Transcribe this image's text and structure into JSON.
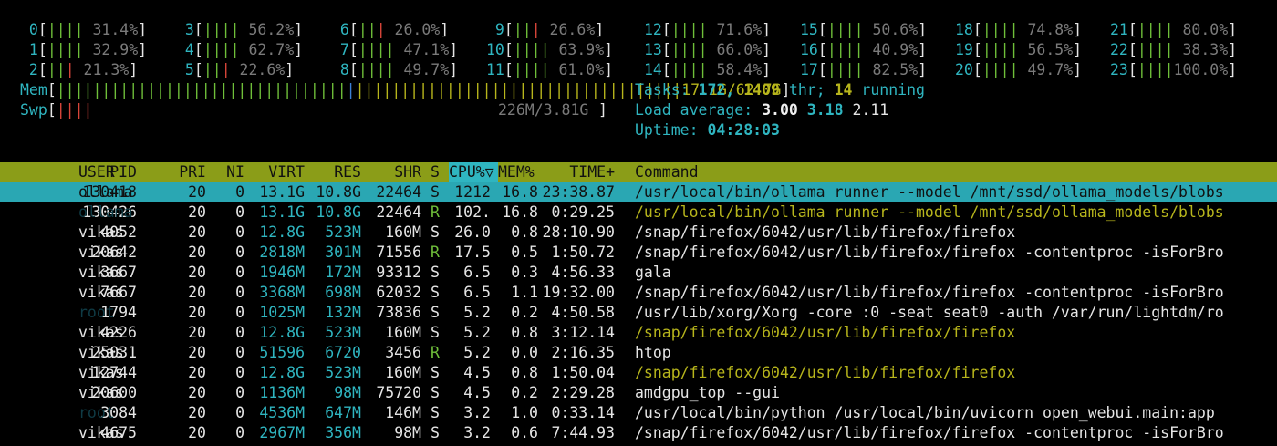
{
  "cpus": [
    {
      "id": "0",
      "pct": "31.4%"
    },
    {
      "id": "1",
      "pct": "32.9%"
    },
    {
      "id": "2",
      "pct": "21.3%"
    },
    {
      "id": "3",
      "pct": "56.2%"
    },
    {
      "id": "4",
      "pct": "62.7%"
    },
    {
      "id": "5",
      "pct": "22.6%"
    },
    {
      "id": "6",
      "pct": "26.0%"
    },
    {
      "id": "7",
      "pct": "47.1%"
    },
    {
      "id": "8",
      "pct": "49.7%"
    },
    {
      "id": "9",
      "pct": "26.6%"
    },
    {
      "id": "10",
      "pct": "63.9%"
    },
    {
      "id": "11",
      "pct": "61.0%"
    },
    {
      "id": "12",
      "pct": "71.6%"
    },
    {
      "id": "13",
      "pct": "66.0%"
    },
    {
      "id": "14",
      "pct": "58.4%"
    },
    {
      "id": "15",
      "pct": "50.6%"
    },
    {
      "id": "16",
      "pct": "40.9%"
    },
    {
      "id": "17",
      "pct": "82.5%"
    },
    {
      "id": "18",
      "pct": "74.8%"
    },
    {
      "id": "19",
      "pct": "56.5%"
    },
    {
      "id": "20",
      "pct": "49.7%"
    },
    {
      "id": "21",
      "pct": "80.0%"
    },
    {
      "id": "22",
      "pct": "38.3%"
    },
    {
      "id": "23",
      "pct": "100.0%"
    }
  ],
  "mem": {
    "label": "Mem",
    "value": "17.1G/62.7G"
  },
  "swp": {
    "label": "Swp",
    "value": "226M/3.81G"
  },
  "tasks": {
    "label": "Tasks:",
    "count": "172,",
    "threads": "1409",
    "thr_label": "thr;",
    "running": "14",
    "running_label": "running"
  },
  "load": {
    "label": "Load average:",
    "l1": "3.00",
    "l5": "3.18",
    "l15": "2.11"
  },
  "uptime": {
    "label": "Uptime:",
    "value": "04:28:03"
  },
  "header": {
    "pid": "PID",
    "user": "USER",
    "pri": "PRI",
    "ni": "NI",
    "virt": "VIRT",
    "res": "RES",
    "shr": "SHR",
    "s": "S",
    "cpu": "CPU%▽",
    "mem": "MEM%",
    "time": "TIME+",
    "command": "Command"
  },
  "processes": [
    {
      "pid": "130418",
      "user": "ollama",
      "pri": "20",
      "ni": "0",
      "virt": "13.1G",
      "res": "10.8G",
      "shr": "22464",
      "s": "S",
      "cpu": "1212",
      "mem": "16.8",
      "time": "23:38.87",
      "command": "/usr/local/bin/ollama runner --model /mnt/ssd/ollama_models/blobs"
    },
    {
      "pid": "130426",
      "user": "ollama",
      "pri": "20",
      "ni": "0",
      "virt": "13.1G",
      "res": "10.8G",
      "shr": "22464",
      "s": "R",
      "cpu": "102.",
      "mem": "16.8",
      "time": "0:29.25",
      "command": "/usr/local/bin/ollama runner --model /mnt/ssd/ollama_models/blobs"
    },
    {
      "pid": "4052",
      "user": "vikas",
      "pri": "20",
      "ni": "0",
      "virt": "12.8G",
      "res": "523M",
      "shr": "160M",
      "s": "S",
      "cpu": "26.0",
      "mem": "0.8",
      "time": "28:10.90",
      "command": "/snap/firefox/6042/usr/lib/firefox/firefox"
    },
    {
      "pid": "20642",
      "user": "vikas",
      "pri": "20",
      "ni": "0",
      "virt": "2818M",
      "res": "301M",
      "shr": "71556",
      "s": "R",
      "cpu": "17.5",
      "mem": "0.5",
      "time": "1:50.72",
      "command": "/snap/firefox/6042/usr/lib/firefox/firefox -contentproc -isForBro"
    },
    {
      "pid": "3667",
      "user": "vikas",
      "pri": "20",
      "ni": "0",
      "virt": "1946M",
      "res": "172M",
      "shr": "93312",
      "s": "S",
      "cpu": "6.5",
      "mem": "0.3",
      "time": "4:56.33",
      "command": "gala"
    },
    {
      "pid": "7667",
      "user": "vikas",
      "pri": "20",
      "ni": "0",
      "virt": "3368M",
      "res": "698M",
      "shr": "62032",
      "s": "S",
      "cpu": "6.5",
      "mem": "1.1",
      "time": "19:32.00",
      "command": "/snap/firefox/6042/usr/lib/firefox/firefox -contentproc -isForBro"
    },
    {
      "pid": "1794",
      "user": "root",
      "pri": "20",
      "ni": "0",
      "virt": "1025M",
      "res": "132M",
      "shr": "73836",
      "s": "S",
      "cpu": "5.2",
      "mem": "0.2",
      "time": "4:50.58",
      "command": "/usr/lib/xorg/Xorg -core :0 -seat seat0 -auth /var/run/lightdm/ro"
    },
    {
      "pid": "4226",
      "user": "vikas",
      "pri": "20",
      "ni": "0",
      "virt": "12.8G",
      "res": "523M",
      "shr": "160M",
      "s": "S",
      "cpu": "5.2",
      "mem": "0.8",
      "time": "3:12.14",
      "command": "/snap/firefox/6042/usr/lib/firefox/firefox"
    },
    {
      "pid": "25031",
      "user": "vikas",
      "pri": "20",
      "ni": "0",
      "virt": "51596",
      "res": "6720",
      "shr": "3456",
      "s": "R",
      "cpu": "5.2",
      "mem": "0.0",
      "time": "2:16.35",
      "command": "htop"
    },
    {
      "pid": "12744",
      "user": "vikas",
      "pri": "20",
      "ni": "0",
      "virt": "12.8G",
      "res": "523M",
      "shr": "160M",
      "s": "S",
      "cpu": "4.5",
      "mem": "0.8",
      "time": "1:50.04",
      "command": "/snap/firefox/6042/usr/lib/firefox/firefox"
    },
    {
      "pid": "20600",
      "user": "vikas",
      "pri": "20",
      "ni": "0",
      "virt": "1136M",
      "res": "98M",
      "shr": "75720",
      "s": "S",
      "cpu": "4.5",
      "mem": "0.2",
      "time": "2:29.28",
      "command": "amdgpu_top --gui"
    },
    {
      "pid": "3084",
      "user": "root",
      "pri": "20",
      "ni": "0",
      "virt": "4536M",
      "res": "647M",
      "shr": "146M",
      "s": "S",
      "cpu": "3.2",
      "mem": "1.0",
      "time": "0:33.14",
      "command": "/usr/local/bin/python /usr/local/bin/uvicorn open_webui.main:app"
    },
    {
      "pid": "4675",
      "user": "vikas",
      "pri": "20",
      "ni": "0",
      "virt": "2967M",
      "res": "356M",
      "shr": "98M",
      "s": "S",
      "cpu": "3.2",
      "mem": "0.6",
      "time": "7:44.93",
      "command": "/snap/firefox/6042/usr/lib/firefox/firefox -contentproc -isForBro"
    }
  ],
  "colors": {
    "header_bg": "#8b9d18",
    "selected_bg": "#2aa7b3",
    "accent": "#2fb5c0",
    "bar_green": "#6fbf3a",
    "bar_red": "#d9453a"
  }
}
